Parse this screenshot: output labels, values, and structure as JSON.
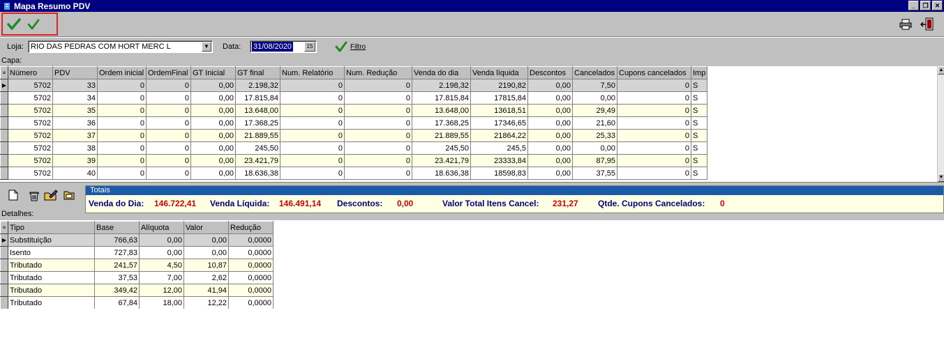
{
  "window": {
    "title": "Mapa Resumo PDV",
    "window_buttons": [
      "_",
      "❐",
      "✕"
    ]
  },
  "toolbar": {
    "confirm_icon": "check-icon",
    "confirm2_icon": "check-icon",
    "print_icon": "printer-icon",
    "exit_icon": "exit-door-icon"
  },
  "filter": {
    "loja_label": "Loja:",
    "loja_value": "RIO DAS PEDRAS COM HORT MERC L",
    "data_label": "Data:",
    "data_value": "31/08/2020",
    "calendar_button": "15",
    "filtro_label": "Filtro"
  },
  "capa": {
    "label": "Capa:",
    "columns": [
      "Número",
      "PDV",
      "Ordem inicial",
      "OrdemFinal",
      "GT Inicial",
      "GT final",
      "Num. Relatório",
      "Num. Redução",
      "Venda do dia",
      "Venda líquida",
      "Descontos",
      "Cancelados",
      "Cupons cancelados",
      "Imp"
    ],
    "rows": [
      [
        "5702",
        "33",
        "0",
        "0",
        "0,00",
        "2.198,32",
        "0",
        "0",
        "2.198,32",
        "2190,82",
        "0,00",
        "7,50",
        "0",
        "S"
      ],
      [
        "5702",
        "34",
        "0",
        "0",
        "0,00",
        "17.815,84",
        "0",
        "0",
        "17.815,84",
        "17815,84",
        "0,00",
        "0,00",
        "0",
        "S"
      ],
      [
        "5702",
        "35",
        "0",
        "0",
        "0,00",
        "13.648,00",
        "0",
        "0",
        "13.648,00",
        "13618,51",
        "0,00",
        "29,49",
        "0",
        "S"
      ],
      [
        "5702",
        "36",
        "0",
        "0",
        "0,00",
        "17.368,25",
        "0",
        "0",
        "17.368,25",
        "17346,65",
        "0,00",
        "21,60",
        "0",
        "S"
      ],
      [
        "5702",
        "37",
        "0",
        "0",
        "0,00",
        "21.889,55",
        "0",
        "0",
        "21.889,55",
        "21864,22",
        "0,00",
        "25,33",
        "0",
        "S"
      ],
      [
        "5702",
        "38",
        "0",
        "0",
        "0,00",
        "245,50",
        "0",
        "0",
        "245,50",
        "245,5",
        "0,00",
        "0,00",
        "0",
        "S"
      ],
      [
        "5702",
        "39",
        "0",
        "0",
        "0,00",
        "23.421,79",
        "0",
        "0",
        "23.421,79",
        "23333,84",
        "0,00",
        "87,95",
        "0",
        "S"
      ],
      [
        "5702",
        "40",
        "0",
        "0",
        "0,00",
        "18.636,38",
        "0",
        "0",
        "18.636,38",
        "18598,83",
        "0,00",
        "37,55",
        "0",
        "S"
      ]
    ]
  },
  "totais": {
    "header": "Totais",
    "venda_dia_label": "Venda do Dia:",
    "venda_dia_value": "146.722,41",
    "venda_liquida_label": "Venda Líquida:",
    "venda_liquida_value": "146.491,14",
    "descontos_label": "Descontos:",
    "descontos_value": "0,00",
    "itens_cancel_label": "Valor Total Itens Cancel:",
    "itens_cancel_value": "231,27",
    "cupons_cancel_label": "Qtde. Cupons Cancelados:",
    "cupons_cancel_value": "0"
  },
  "detalhes": {
    "label": "Detalhes:",
    "columns": [
      "Tipo",
      "Base",
      "Alíquota",
      "Valor",
      "Redução"
    ],
    "rows": [
      [
        "Substituição",
        "766,63",
        "0,00",
        "0,00",
        "0,0000"
      ],
      [
        "Isento",
        "727,83",
        "0,00",
        "0,00",
        "0,0000"
      ],
      [
        "Tributado",
        "241,57",
        "4,50",
        "10,87",
        "0,0000"
      ],
      [
        "Tributado",
        "37,53",
        "7,00",
        "2,62",
        "0,0000"
      ],
      [
        "Tributado",
        "349,42",
        "12,00",
        "41,94",
        "0,0000"
      ],
      [
        "Tributado",
        "67,84",
        "18,00",
        "12,22",
        "0,0000"
      ]
    ]
  }
}
